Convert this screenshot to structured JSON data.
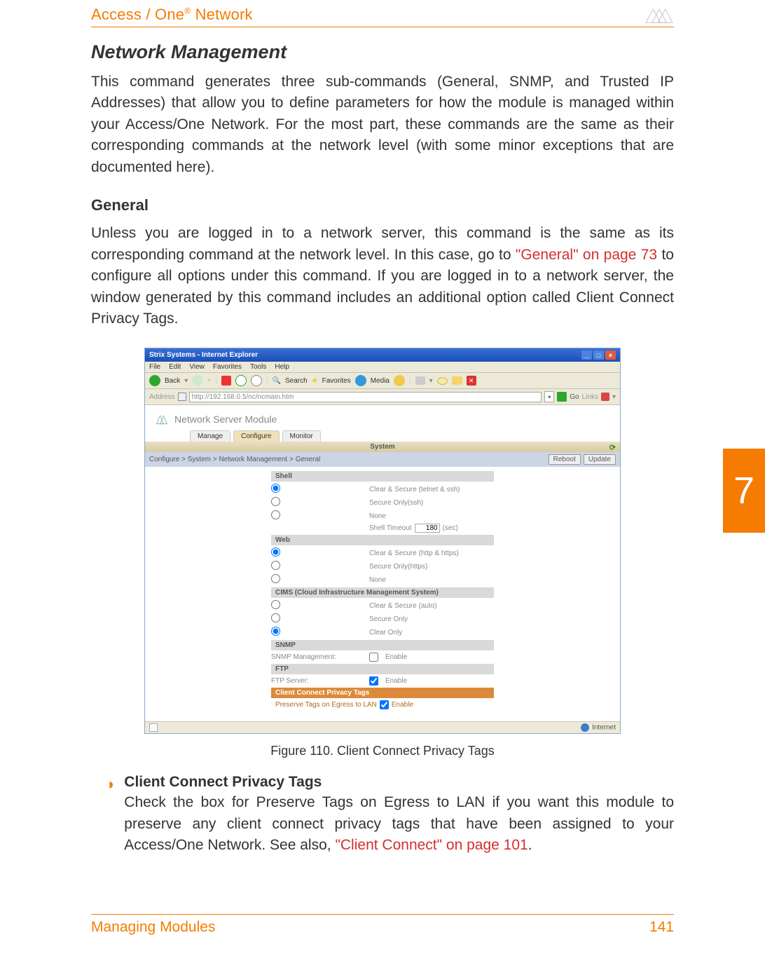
{
  "header": {
    "brand_prefix": "Access / One",
    "brand_reg": "®",
    "brand_suffix": " Network"
  },
  "side_tab": "7",
  "section": {
    "title": "Network Management",
    "intro": "This command generates three sub-commands (General, SNMP, and Trusted IP Addresses) that allow you to define parameters for how the module is managed within your Access/One Network. For the most part, these commands are the same as their corresponding commands at the network level (with some minor exceptions that are documented here).",
    "sub_title": "General",
    "sub_p_before": "Unless you are logged in to a network server, this command is the same as its corresponding command at the network level. In this case, go to ",
    "sub_link1": "\"General\" on page 73",
    "sub_p_mid": " to configure all options under this command. If you are logged in to a network server, the window generated by this command includes an additional option called Client Connect Privacy Tags."
  },
  "figure": {
    "caption": "Figure 110. Client Connect Privacy Tags"
  },
  "bullet": {
    "head": "Client Connect Privacy Tags",
    "body_before": "Check the box for Preserve Tags on Egress to LAN if you want this module to preserve any client connect privacy tags that have been assigned to your Access/One Network. See also, ",
    "link": "\"Client Connect\" on page 101",
    "body_after": "."
  },
  "footer": {
    "left": "Managing Modules",
    "right": "141"
  },
  "screenshot": {
    "title": "Strix Systems - Internet Explorer",
    "menu": [
      "File",
      "Edit",
      "View",
      "Favorites",
      "Tools",
      "Help"
    ],
    "toolbar": {
      "back": "Back",
      "search": "Search",
      "favorites": "Favorites",
      "media": "Media"
    },
    "address_label": "Address",
    "address_value": "http://192.168.0.5/nc/ncmain.htm",
    "go": "Go",
    "links": "Links",
    "module_title": "Network Server Module",
    "tabs": [
      "Manage",
      "Configure",
      "Monitor"
    ],
    "subbar": "System",
    "breadcrumb": "Configure > System > Network Management > General",
    "buttons": {
      "reboot": "Reboot",
      "update": "Update"
    },
    "sections": {
      "shell": {
        "head": "Shell",
        "opt1": "Clear & Secure (telnet & ssh)",
        "opt2": "Secure Only(ssh)",
        "opt3": "None",
        "timeout_label": "Shell Timeout",
        "timeout_value": "180",
        "timeout_unit": "(sec)"
      },
      "web": {
        "head": "Web",
        "opt1": "Clear & Secure (http & https)",
        "opt2": "Secure Only(https)",
        "opt3": "None"
      },
      "cims": {
        "head": "CIMS (Cloud Infrastructure Management System)",
        "opt1": "Clear & Secure (auto)",
        "opt2": "Secure Only",
        "opt3": "Clear Only"
      },
      "snmp": {
        "head": "SNMP",
        "label": "SNMP Management:",
        "enable": "Enable"
      },
      "ftp": {
        "head": "FTP",
        "label": "FTP Server:",
        "enable": "Enable"
      },
      "ccpt": {
        "head": "Client Connect Privacy Tags",
        "label": "Preserve Tags on Egress to LAN",
        "enable": "Enable"
      }
    },
    "status": "Internet"
  }
}
